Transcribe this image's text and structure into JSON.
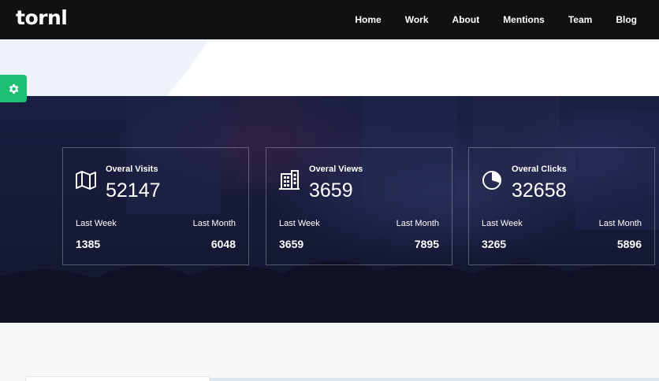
{
  "header": {
    "brand": "tornl",
    "nav": [
      "Home",
      "Work",
      "About",
      "Mentions",
      "Team",
      "Blog"
    ]
  },
  "settings": {
    "icon": "gear-icon",
    "color": "#1fbf73"
  },
  "stats": [
    {
      "icon": "map-icon",
      "title": "Overal Visits",
      "total": "52147",
      "last_week_label": "Last Week",
      "last_week": "1385",
      "last_month_label": "Last Month",
      "last_month": "6048"
    },
    {
      "icon": "building-icon",
      "title": "Overal Views",
      "total": "3659",
      "last_week_label": "Last Week",
      "last_week": "3659",
      "last_month_label": "Last Month",
      "last_month": "7895"
    },
    {
      "icon": "pie-chart-icon",
      "title": "Overal Clicks",
      "total": "32658",
      "last_week_label": "Last Week",
      "last_week": "3265",
      "last_month_label": "Last Month",
      "last_month": "5896"
    }
  ],
  "colors": {
    "header_bg": "#111111",
    "stats_bg": "#161a38",
    "accent": "#1fbf73"
  }
}
